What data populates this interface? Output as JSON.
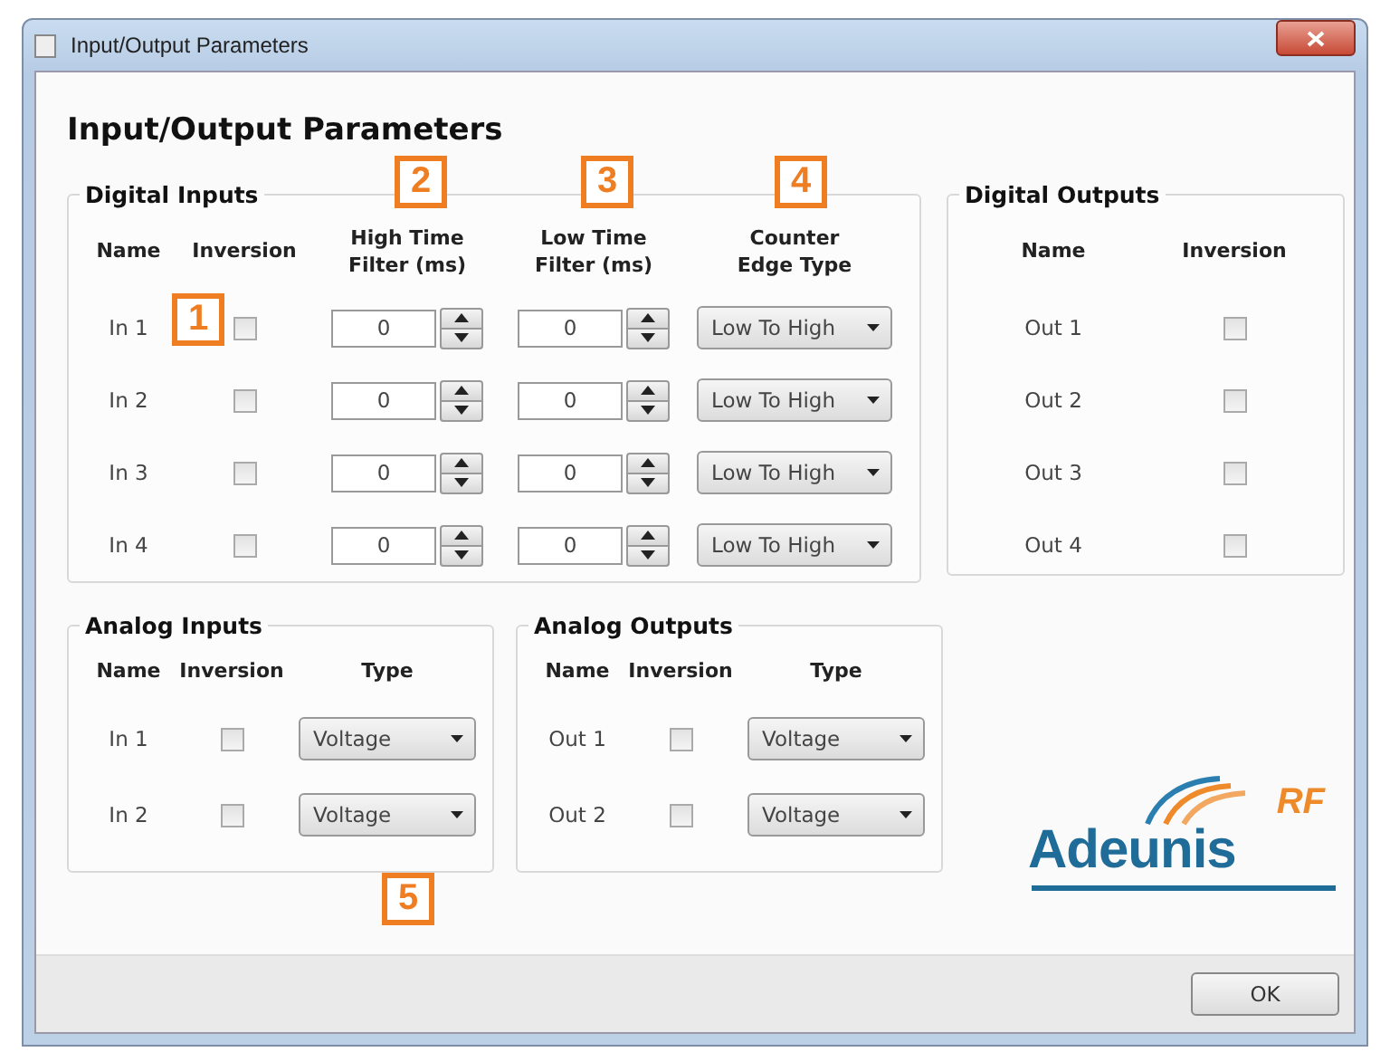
{
  "window": {
    "title": "Input/Output Parameters"
  },
  "heading": "Input/Output Parameters",
  "digital_inputs": {
    "title": "Digital Inputs",
    "columns": [
      "Name",
      "Inversion",
      "High Time\nFilter (ms)",
      "Low Time\nFilter (ms)",
      "Counter\nEdge Type"
    ],
    "rows": [
      {
        "name": "In 1",
        "inversion": false,
        "high_filter": "0",
        "low_filter": "0",
        "edge_type": "Low To High"
      },
      {
        "name": "In 2",
        "inversion": false,
        "high_filter": "0",
        "low_filter": "0",
        "edge_type": "Low To High"
      },
      {
        "name": "In 3",
        "inversion": false,
        "high_filter": "0",
        "low_filter": "0",
        "edge_type": "Low To High"
      },
      {
        "name": "In 4",
        "inversion": false,
        "high_filter": "0",
        "low_filter": "0",
        "edge_type": "Low To High"
      }
    ]
  },
  "digital_outputs": {
    "title": "Digital Outputs",
    "columns": [
      "Name",
      "Inversion"
    ],
    "rows": [
      {
        "name": "Out 1",
        "inversion": false
      },
      {
        "name": "Out 2",
        "inversion": false
      },
      {
        "name": "Out 3",
        "inversion": false
      },
      {
        "name": "Out 4",
        "inversion": false
      }
    ]
  },
  "analog_inputs": {
    "title": "Analog Inputs",
    "columns": [
      "Name",
      "Inversion",
      "Type"
    ],
    "rows": [
      {
        "name": "In 1",
        "inversion": false,
        "type": "Voltage"
      },
      {
        "name": "In 2",
        "inversion": false,
        "type": "Voltage"
      }
    ]
  },
  "analog_outputs": {
    "title": "Analog Outputs",
    "columns": [
      "Name",
      "Inversion",
      "Type"
    ],
    "rows": [
      {
        "name": "Out 1",
        "inversion": false,
        "type": "Voltage"
      },
      {
        "name": "Out 2",
        "inversion": false,
        "type": "Voltage"
      }
    ]
  },
  "logo": {
    "brand": "Adeunis",
    "suffix": "RF"
  },
  "buttons": [
    "OK"
  ],
  "callouts": [
    {
      "label": "1"
    },
    {
      "label": "2"
    },
    {
      "label": "3"
    },
    {
      "label": "4"
    },
    {
      "label": "5"
    }
  ]
}
